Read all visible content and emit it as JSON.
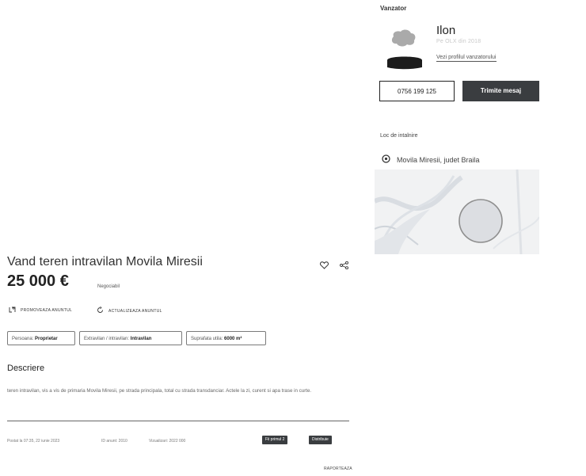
{
  "seller": {
    "heading": "Vanzator",
    "name": "Ilon",
    "subtitle": "Pe OLX din 2018",
    "profile_link": "Vezi profilul vanzatorului",
    "phone_button": "0756 199 125",
    "message_button": "Trimite mesaj"
  },
  "location": {
    "heading": "Loc de intalnire",
    "text": "Movila Miresii, judet Braila"
  },
  "listing": {
    "title": "Vand teren intravilan Movila Miresii",
    "price": "25 000 €",
    "negotiable": "Negociabil",
    "promote": "PROMOVEAZA ANUNTUL",
    "refresh": "ACTUALIZEAZA ANUNTUL",
    "tags": [
      {
        "label": "Persoana:",
        "value": "Proprietar"
      },
      {
        "label": "Extravilan / intravilan:",
        "value": "Intravilan"
      },
      {
        "label": "Suprafata utila:",
        "value": "6000 m²"
      }
    ]
  },
  "description": {
    "heading": "Descriere",
    "body": "teren intravilan, vis a vis de primaria Movila Miresii, pe strada principala, total cu strada transdanciar. Actele la zi, curent si apa trase in curte."
  },
  "meta": {
    "posted": "Postat la 07:35, 22 iunie 2023",
    "id": "ID anunt: 2010",
    "views": "Vizualizari: 2022 000",
    "badge_1": "Fii primul 2",
    "badge_2": "Distribuie",
    "report": "RAPORTEAZA"
  }
}
